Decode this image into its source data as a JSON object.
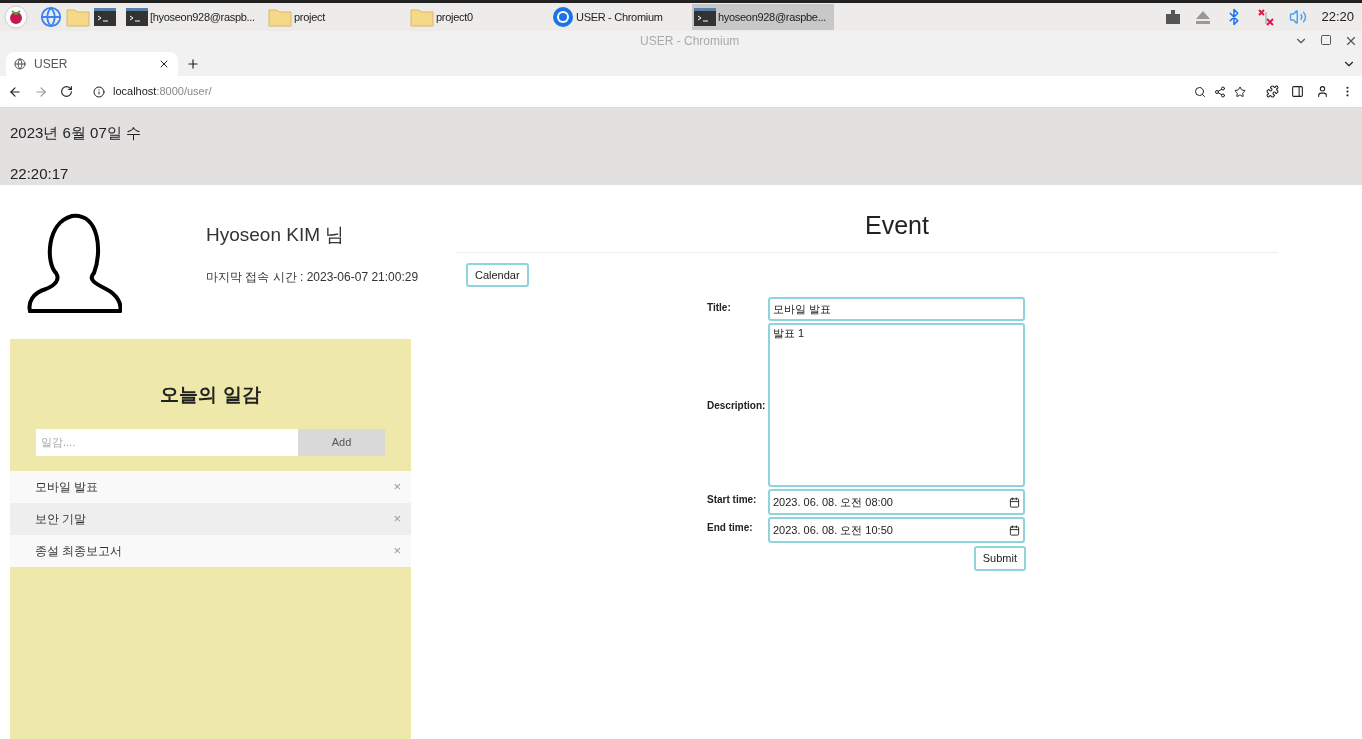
{
  "taskbar": {
    "tasks": [
      {
        "kind": "terminal",
        "label": "[hyoseon928@raspb...",
        "selected": false
      },
      {
        "kind": "folder",
        "label": "project",
        "selected": false
      },
      {
        "kind": "folder",
        "label": "project0",
        "selected": false
      },
      {
        "kind": "browser",
        "label": "USER - Chromium",
        "selected": false
      },
      {
        "kind": "terminal",
        "label": "hyoseon928@raspbe...",
        "selected": true
      }
    ],
    "clock": "22:20"
  },
  "window": {
    "title": "USER - Chromium"
  },
  "tabs": [
    {
      "label": "USER",
      "selected": true
    }
  ],
  "address": {
    "host": "localhost",
    "rest": ":8000/user/"
  },
  "header": {
    "date": "2023년 6월 07일 수",
    "time": "22:20:17"
  },
  "profile": {
    "name": "Hyoseon KIM 님",
    "last_login": "마지막 접속 시간 : 2023-06-07 21:00:29"
  },
  "todo": {
    "title": "오늘의 일감",
    "placeholder": "일감....",
    "add_button": "Add",
    "items": [
      {
        "label": "모바일 발표",
        "close": "×"
      },
      {
        "label": "보안 기말",
        "close": "×"
      },
      {
        "label": "종설 최종보고서",
        "close": "×"
      }
    ]
  },
  "event": {
    "title": "Event",
    "calendar_button": "Calendar",
    "fields": [
      {
        "kind": "text",
        "label": "Title:",
        "value": "모바일 발표"
      },
      {
        "kind": "textarea",
        "label": "Description:",
        "value": "발표 1"
      },
      {
        "kind": "datetime",
        "label": "Start time:",
        "value": "2023. 06. 08. 오전 08:00"
      },
      {
        "kind": "datetime",
        "label": "End time:",
        "value": "2023. 06. 08. 오전 10:50"
      }
    ],
    "submit": "Submit"
  }
}
